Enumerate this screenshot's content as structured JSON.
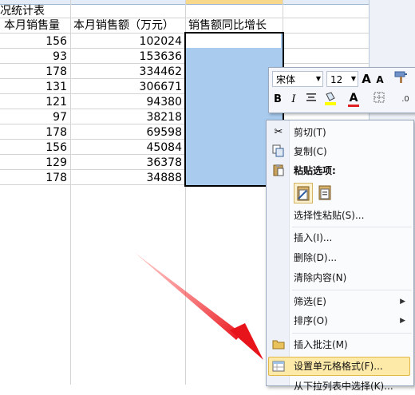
{
  "sheet": {
    "title_fragment": "况统计表",
    "headers": [
      "本月销售量",
      "本月销售额（万元）",
      "销售额同比增长"
    ],
    "rows": [
      {
        "qty": "156",
        "sales": "102024"
      },
      {
        "qty": "93",
        "sales": "153636"
      },
      {
        "qty": "178",
        "sales": "334462"
      },
      {
        "qty": "131",
        "sales": "306671"
      },
      {
        "qty": "121",
        "sales": "94380"
      },
      {
        "qty": "97",
        "sales": "38218"
      },
      {
        "qty": "178",
        "sales": "69598"
      },
      {
        "qty": "156",
        "sales": "45084"
      },
      {
        "qty": "129",
        "sales": "36378"
      },
      {
        "qty": "178",
        "sales": "34888"
      }
    ]
  },
  "mini_toolbar": {
    "font_name": "宋体",
    "font_size": "12",
    "grow_font": "A",
    "shrink_font": "A",
    "bold": "B",
    "italic": "I",
    "font_color_letter": "A",
    "font_color": "#e02020",
    "fill_color": "#ffff00"
  },
  "context_menu": {
    "items": [
      {
        "label": "剪切(T)",
        "icon": "scissors-icon"
      },
      {
        "label": "复制(C)",
        "icon": "copy-icon"
      },
      {
        "label": "粘贴选项:",
        "icon": "clipboard-icon"
      },
      {
        "label": "选择性粘贴(S)..."
      },
      {
        "label": "插入(I)..."
      },
      {
        "label": "删除(D)..."
      },
      {
        "label": "清除内容(N)"
      },
      {
        "label": "筛选(E)"
      },
      {
        "label": "排序(O)"
      },
      {
        "label": "插入批注(M)",
        "icon": "comment-icon"
      },
      {
        "label": "设置单元格格式(F)...",
        "icon": "format-cells-icon"
      },
      {
        "label": "从下拉列表中选择(K)..."
      }
    ]
  },
  "annotation": {
    "arrow_color": "#e8141b"
  }
}
